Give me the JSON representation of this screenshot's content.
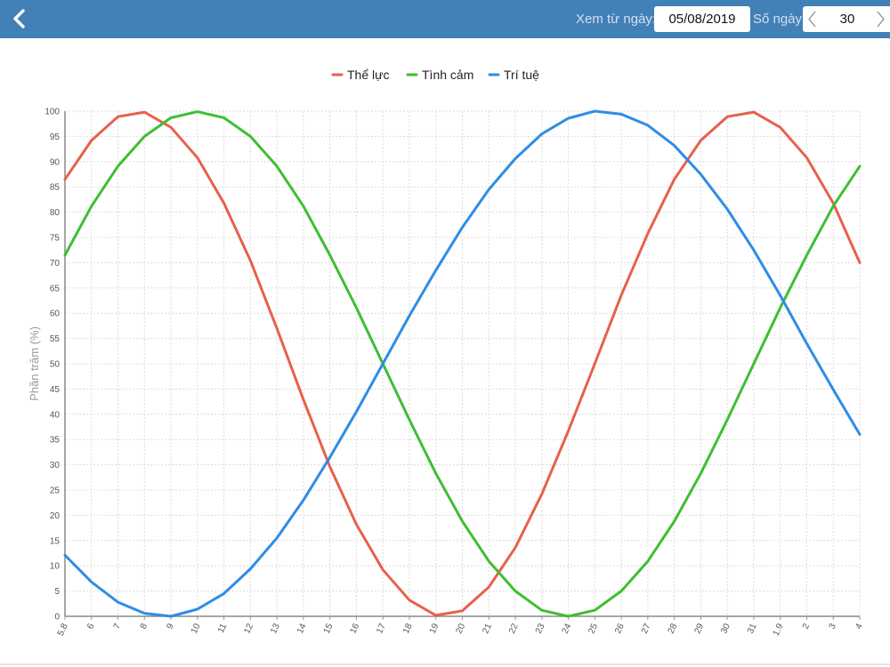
{
  "header": {
    "from_label": "Xem từ ngày:",
    "date_value": "05/08/2019",
    "days_label": "Số ngày:",
    "days_value": "30"
  },
  "colors": {
    "header_bg": "#4280b8",
    "physical": "#e8604c",
    "emotional": "#3fbe32",
    "intellectual": "#2f8ce6"
  },
  "chart_data": {
    "type": "line",
    "ylabel": "Phần trăm (%)",
    "xlabel": "",
    "ylim": [
      0,
      100
    ],
    "yticks": [
      0,
      5,
      10,
      15,
      20,
      25,
      30,
      35,
      40,
      45,
      50,
      55,
      60,
      65,
      70,
      75,
      80,
      85,
      90,
      95,
      100
    ],
    "grid": true,
    "legend_position": "top-center",
    "categories": [
      "5.8",
      "6",
      "7",
      "8",
      "9",
      "10",
      "11",
      "12",
      "13",
      "14",
      "15",
      "16",
      "17",
      "18",
      "19",
      "20",
      "21",
      "22",
      "23",
      "24",
      "25",
      "26",
      "27",
      "28",
      "29",
      "30",
      "31",
      "1.9",
      "2",
      "3",
      "4"
    ],
    "series": [
      {
        "name": "Thể lực",
        "color": "#e8604c",
        "values": [
          86.5,
          94.2,
          98.9,
          99.8,
          96.8,
          90.8,
          81.8,
          70.4,
          57.0,
          42.9,
          29.6,
          18.2,
          9.2,
          3.2,
          0.2,
          1.1,
          5.8,
          13.6,
          24.2,
          36.7,
          50.0,
          63.6,
          75.8,
          86.5,
          94.2,
          98.9,
          99.8,
          96.8,
          90.8,
          81.8,
          70.0
        ]
      },
      {
        "name": "Tình cảm",
        "color": "#3fbe32",
        "values": [
          71.5,
          81.2,
          89.1,
          95.0,
          98.7,
          99.9,
          98.7,
          95.0,
          89.1,
          81.2,
          71.5,
          61.1,
          50.0,
          38.9,
          28.3,
          18.8,
          10.9,
          5.0,
          1.2,
          0.0,
          1.2,
          5.0,
          10.9,
          18.8,
          28.3,
          38.9,
          50.0,
          61.1,
          71.5,
          81.2,
          89.1
        ]
      },
      {
        "name": "Trí tuệ",
        "color": "#2f8ce6",
        "values": [
          12.1,
          6.8,
          2.8,
          0.6,
          0.0,
          1.4,
          4.5,
          9.4,
          15.5,
          23.0,
          31.5,
          40.5,
          50.0,
          59.5,
          68.5,
          77.0,
          84.5,
          90.6,
          95.5,
          98.6,
          100.0,
          99.4,
          97.2,
          93.2,
          87.5,
          80.6,
          72.5,
          63.5,
          54.0,
          44.9,
          36.0
        ]
      }
    ]
  }
}
